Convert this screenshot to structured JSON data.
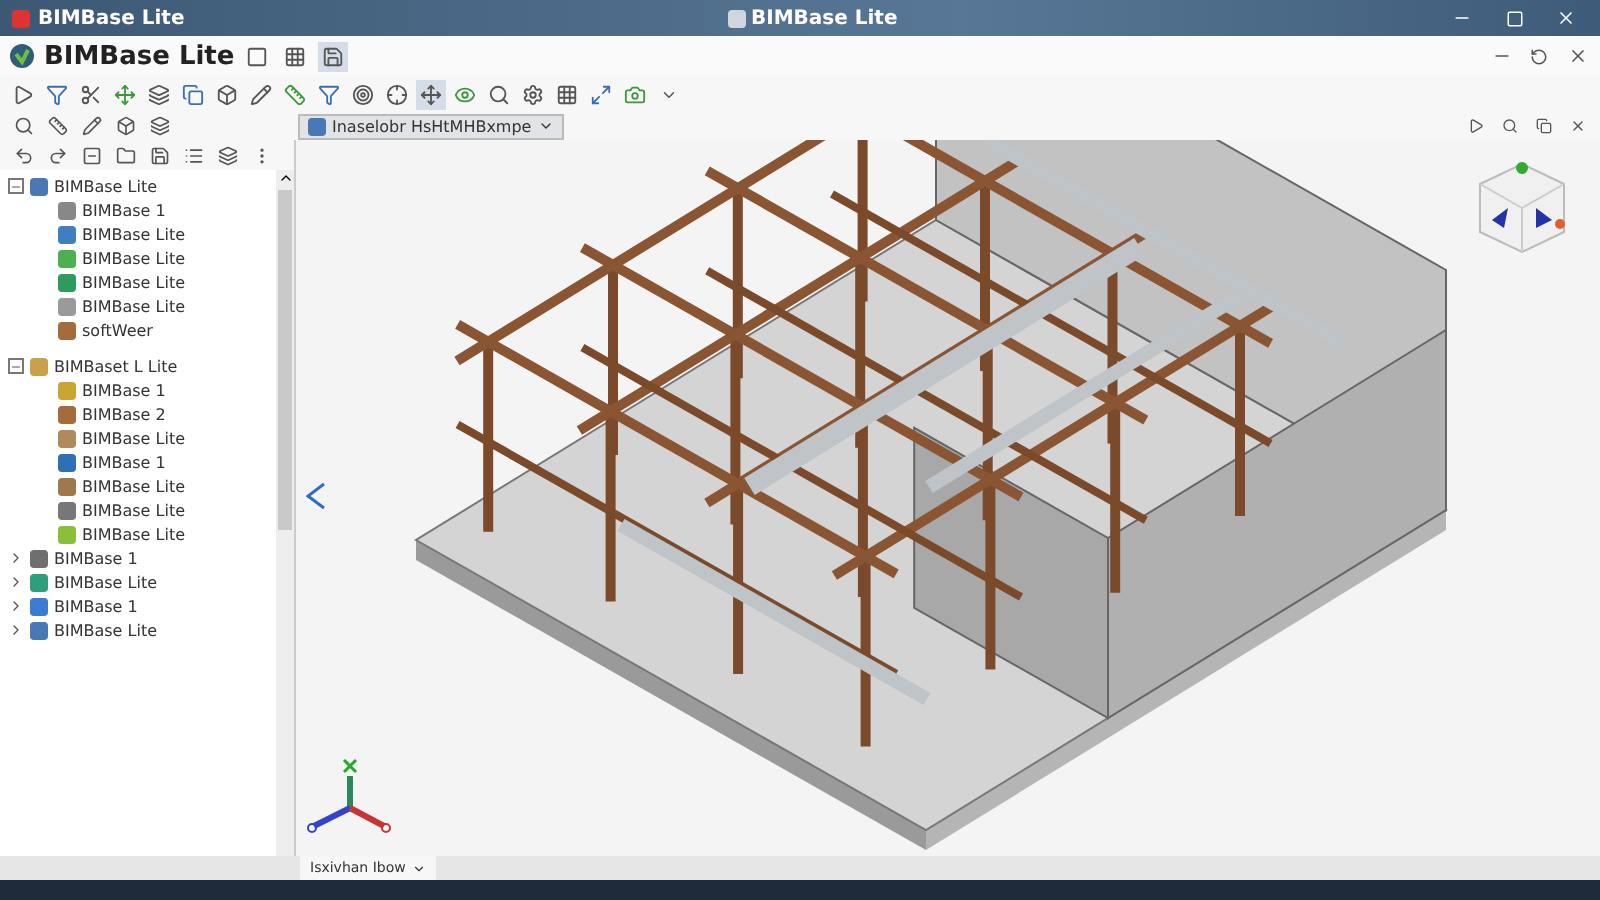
{
  "window": {
    "title": "BIMBase Lite",
    "center_title": "BIMBase Lite"
  },
  "app_bar": {
    "title": "BIMBase Lite"
  },
  "document_selector": {
    "value": "Inaselobr HsHtMHBxmpe"
  },
  "tree": [
    {
      "label": "BIMBase Lite",
      "expanded": true,
      "children": [
        {
          "label": "BIMBase 1"
        },
        {
          "label": "BIMBase Lite"
        },
        {
          "label": "BIMBase Lite"
        },
        {
          "label": "BIMBase Lite"
        },
        {
          "label": "BIMBase Lite"
        },
        {
          "label": "softWeer"
        }
      ]
    },
    {
      "label": "BIMBaset L Lite",
      "expanded": true,
      "children": [
        {
          "label": "BIMBase 1"
        },
        {
          "label": "BIMBase 2"
        },
        {
          "label": "BIMBase Lite"
        },
        {
          "label": "BIMBase 1"
        },
        {
          "label": "BIMBase Lite"
        },
        {
          "label": "BIMBase Lite"
        },
        {
          "label": "BIMBase Lite"
        }
      ]
    },
    {
      "label": "BIMBase 1",
      "expanded": false
    },
    {
      "label": "BIMBase Lite",
      "expanded": false
    },
    {
      "label": "BIMBase 1",
      "expanded": false
    },
    {
      "label": "BIMBase Lite",
      "expanded": false
    }
  ],
  "view_tabs": [
    {
      "label": "Isxivhan Ibow",
      "selected": true
    }
  ]
}
